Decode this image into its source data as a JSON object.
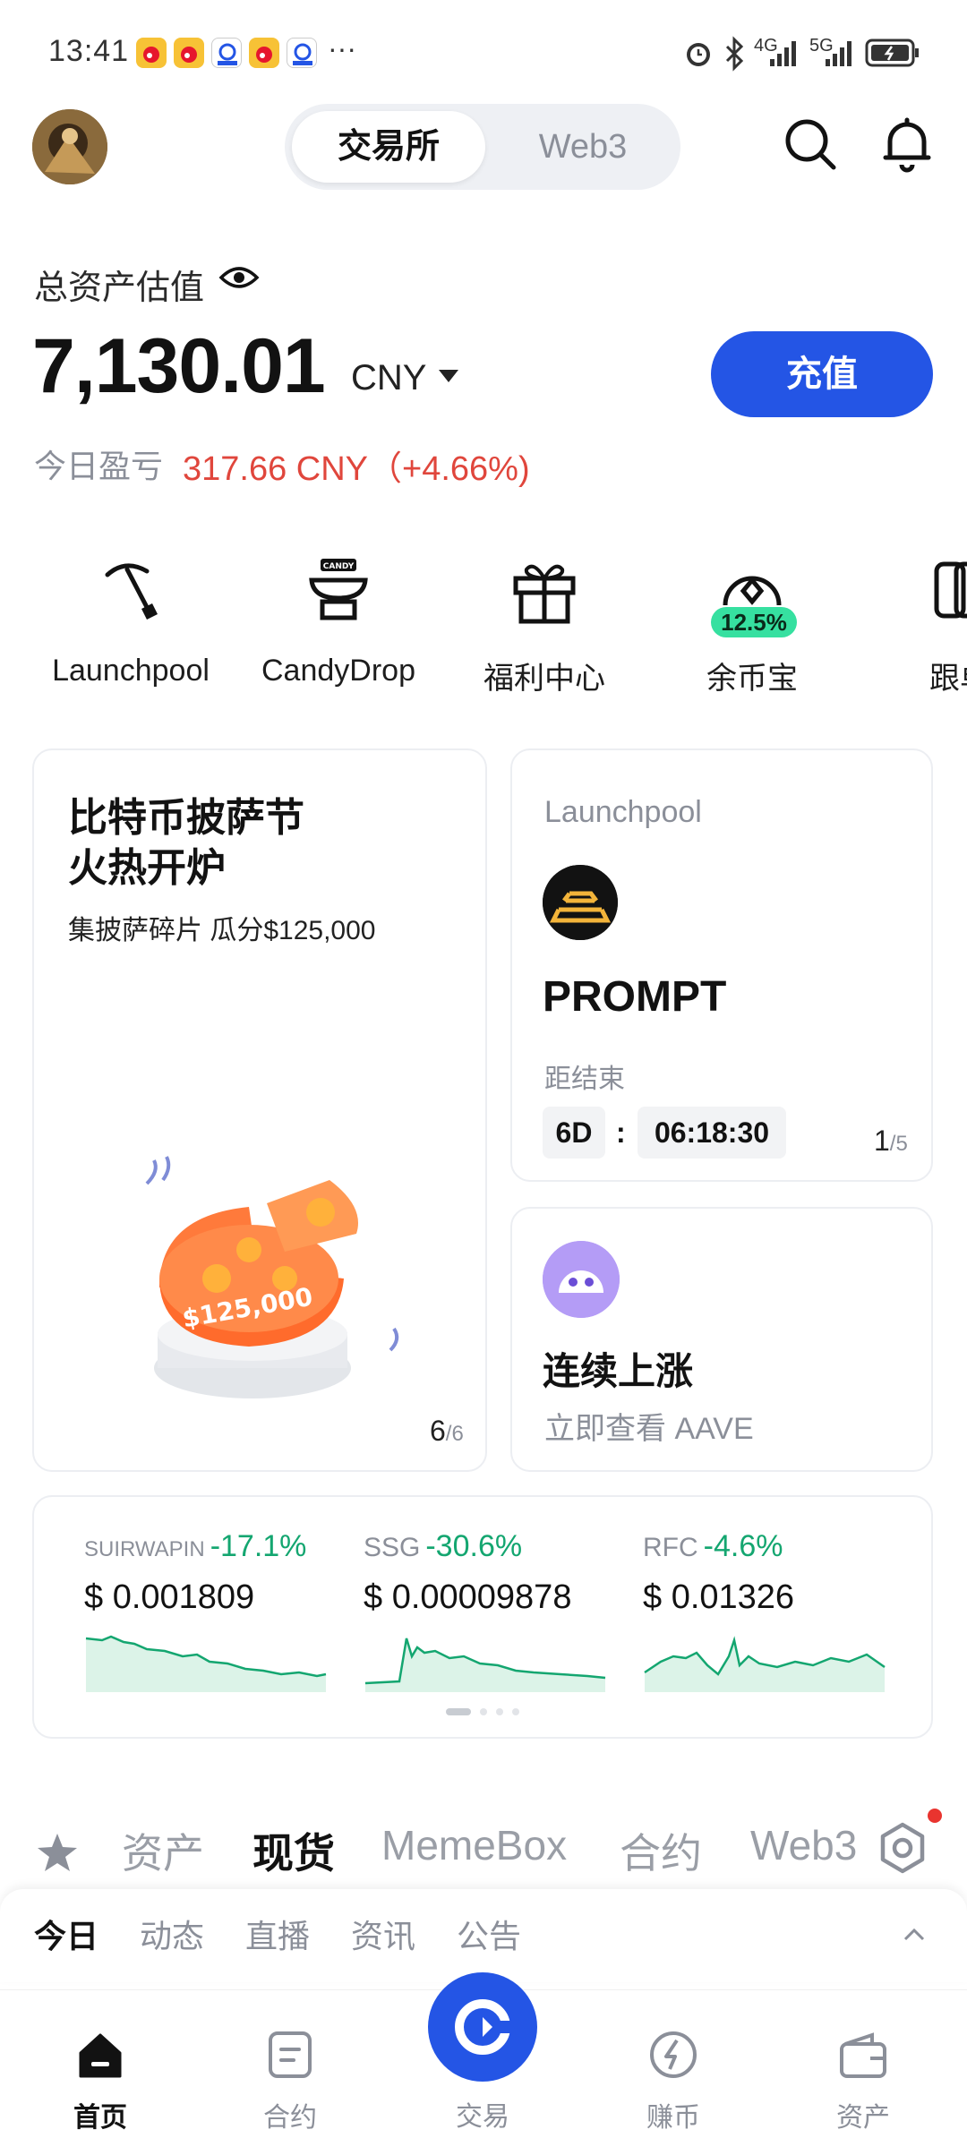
{
  "status_bar": {
    "time": "13:41",
    "more": "···",
    "net1": "4G",
    "net2": "5G"
  },
  "header": {
    "tabs": [
      "交易所",
      "Web3"
    ],
    "active_tab": 0,
    "icons": [
      "search-icon",
      "bell-icon"
    ]
  },
  "assets": {
    "label": "总资产估值",
    "value": "7,130.01",
    "currency": "CNY",
    "deposit": "充值",
    "pnl_label": "今日盈亏",
    "pnl_value": "317.66 CNY（+4.66%)"
  },
  "quick": [
    {
      "label": "Launchpool",
      "icon": "pickaxe-icon"
    },
    {
      "label": "CandyDrop",
      "icon": "candy-icon"
    },
    {
      "label": "福利中心",
      "icon": "gift-icon"
    },
    {
      "label": "余币宝",
      "icon": "savings-icon",
      "badge": "12.5%"
    },
    {
      "label": "跟单",
      "icon": "copy-trade-icon"
    }
  ],
  "promo": {
    "title1": "比特币披萨节",
    "title2": "火热开炉",
    "subtitle": "集披萨碎片 瓜分$125,000",
    "pizza_text": "$125,000",
    "page_cur": "6",
    "page_total": "/6"
  },
  "launchpool": {
    "label": "Launchpool",
    "token": "PROMPT",
    "ends_label": "距结束",
    "days": "6D",
    "colon": ":",
    "time": "06:18:30",
    "page_cur": "1",
    "page_total": "/5"
  },
  "trend": {
    "title": "连续上涨",
    "subtitle": "立即查看 AAVE"
  },
  "tickers": [
    {
      "name": "SUIRWAPIN",
      "change": "-17.1%",
      "price": "$ 0.001809"
    },
    {
      "name": "SSG",
      "change": "-30.6%",
      "price": "$ 0.00009878"
    },
    {
      "name": "RFC",
      "change": "-4.6%",
      "price": "$ 0.01326"
    }
  ],
  "market_tabs": [
    "资产",
    "现货",
    "MemeBox",
    "合约",
    "Web3"
  ],
  "market_active": 1,
  "sub_tabs": [
    "今日",
    "动态",
    "直播",
    "资讯",
    "公告"
  ],
  "sub_active": 0,
  "nav": [
    {
      "label": "首页",
      "icon": "home-icon"
    },
    {
      "label": "合约",
      "icon": "contract-icon"
    },
    {
      "label": "交易",
      "icon": "trade-icon"
    },
    {
      "label": "赚币",
      "icon": "earn-icon"
    },
    {
      "label": "资产",
      "icon": "wallet-icon"
    }
  ],
  "nav_active": 0,
  "colors": {
    "accent": "#2455e5",
    "up": "#e0463c",
    "down": "#14a670",
    "badge": "#36e0a0"
  }
}
